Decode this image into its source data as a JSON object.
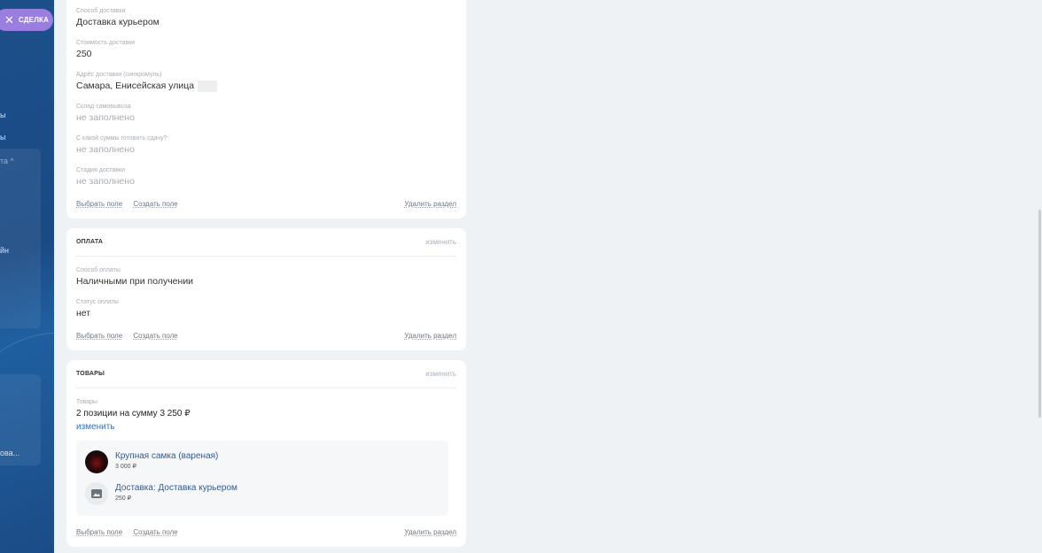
{
  "sidebar": {
    "deal_button": "СДЕЛКА",
    "fragments": [
      "ы",
      "ы",
      "та ^",
      "йн",
      "ова..."
    ]
  },
  "delivery_fields": [
    {
      "label": "Способ доставки",
      "value": "Доставка курьером"
    },
    {
      "label": "Стоимость доставки",
      "value": "250"
    },
    {
      "label": "Адрес доставки (синхромуль)",
      "value": "Самара, Енисейская улица"
    },
    {
      "label": "Склад самовывоза",
      "value": "не заполнено"
    },
    {
      "label": "С какой суммы готовить сдачу?",
      "value": "не заполнено"
    },
    {
      "label": "Стадия доставки",
      "value": "не заполнено"
    }
  ],
  "common": {
    "choose_field": "Выбрать поле",
    "create_field": "Создать поле",
    "delete_section": "Удалить раздел",
    "edit": "изменить"
  },
  "payment": {
    "title": "ОПЛАТА",
    "fields": [
      {
        "label": "Способ оплаты",
        "value": "Наличными при получении"
      },
      {
        "label": "Статус оплаты",
        "value": "нет"
      }
    ]
  },
  "products": {
    "title": "ТОВАРЫ",
    "label": "Товары",
    "summary": "2 позиции на сумму 3 250 ₽",
    "edit_link": "изменить",
    "items": [
      {
        "name": "Крупная самка (вареная)",
        "price": "3 000 ₽",
        "icon": "product-photo"
      },
      {
        "name": "Доставка: Доставка курьером",
        "price": "250 ₽",
        "icon": "image-placeholder-icon"
      }
    ]
  }
}
